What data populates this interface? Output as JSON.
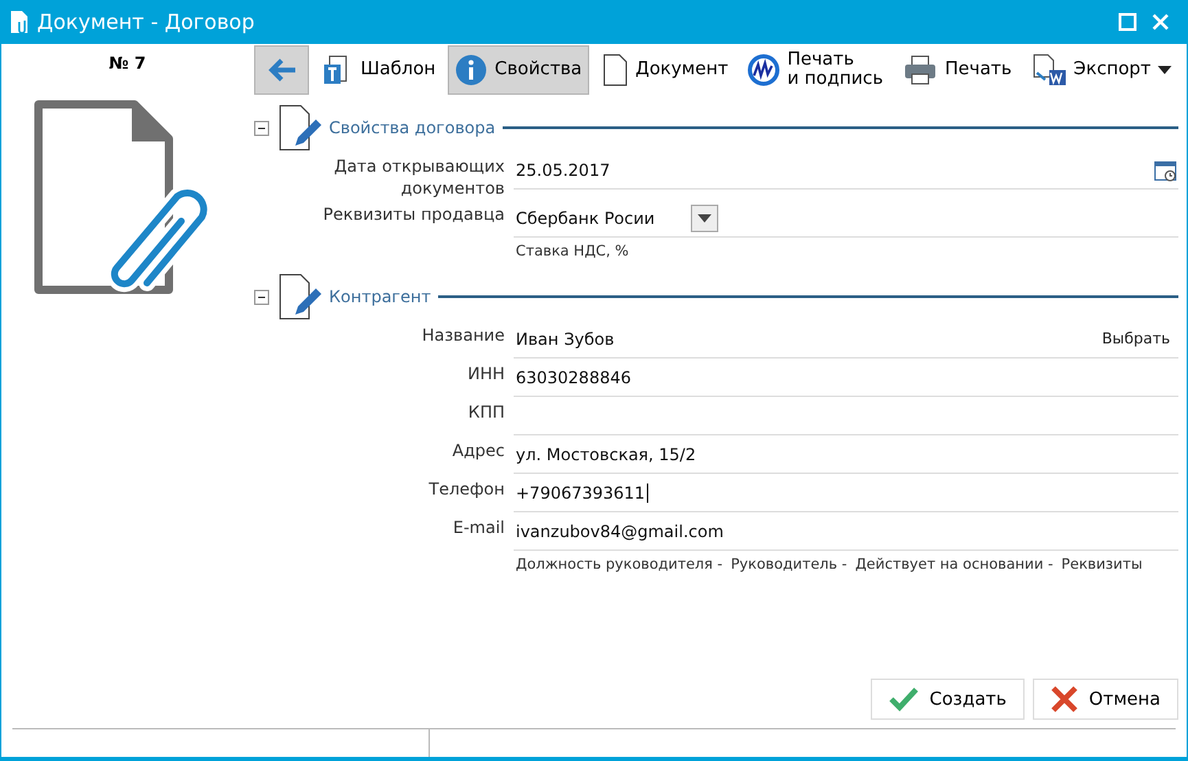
{
  "window": {
    "title": "Документ - Договор"
  },
  "document_number": "№ 7",
  "toolbar": [
    {
      "kind": "back",
      "selected": true
    },
    {
      "kind": "template",
      "label": "Шаблон",
      "selected": false
    },
    {
      "kind": "info",
      "label": "Свойства",
      "selected": true
    },
    {
      "kind": "document",
      "label": "Документ",
      "selected": false
    },
    {
      "kind": "stamp",
      "label": "Печать\nи подпись",
      "selected": false
    },
    {
      "kind": "print",
      "label": "Печать",
      "selected": false
    },
    {
      "kind": "export",
      "label": "Экспорт",
      "selected": false
    }
  ],
  "sections": [
    {
      "title": "Свойства договора",
      "expanded": true,
      "fields": [
        {
          "kind": "date",
          "label": "Дата открывающих документов",
          "value": "25.05.2017"
        },
        {
          "kind": "dropdown",
          "label": "Реквизиты продавца",
          "value": "Сбербанк Росии"
        }
      ],
      "hints": [
        "Ставка НДС, %"
      ]
    },
    {
      "title": "Контрагент",
      "expanded": true,
      "fields": [
        {
          "kind": "pick",
          "label": "Название",
          "value": "Иван Зубов",
          "action": "Выбрать"
        },
        {
          "kind": "text",
          "label": "ИНН",
          "value": "63030288846"
        },
        {
          "kind": "text",
          "label": "КПП"
        },
        {
          "kind": "text",
          "label": "Адрес",
          "value": "ул. Мостовская, 15/2"
        },
        {
          "kind": "text",
          "label": "Телефон",
          "value": "+79067393611",
          "focused": true
        },
        {
          "kind": "text",
          "label": "E-mail",
          "value": "ivanzubov84@gmail.com"
        }
      ],
      "hints": [
        "Должность руководителя -",
        "Руководитель -",
        "Действует на основании -",
        "Реквизиты"
      ]
    }
  ],
  "buttons": [
    {
      "kind": "ok",
      "label": "Создать"
    },
    {
      "kind": "cancel",
      "label": "Отмена"
    }
  ]
}
